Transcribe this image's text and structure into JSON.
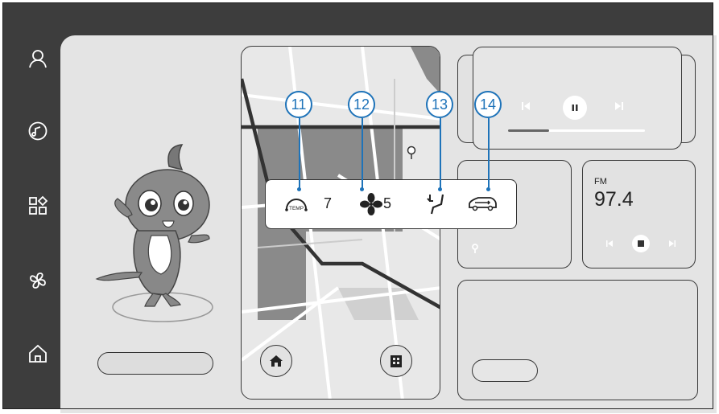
{
  "sidebar": {
    "items": [
      {
        "name": "profile-icon"
      },
      {
        "name": "music-icon"
      },
      {
        "name": "apps-icon"
      },
      {
        "name": "fan-icon"
      },
      {
        "name": "home-icon"
      }
    ]
  },
  "climate": {
    "temp_label": "TEMP",
    "temp_value": "7",
    "fan_value": "5"
  },
  "callouts": [
    "11",
    "12",
    "13",
    "14"
  ],
  "radio": {
    "band": "FM",
    "frequency": "97.4"
  },
  "media": {
    "progress": 0.3
  },
  "colors": {
    "callout": "#1e73b9",
    "frame": "#3d3d3d",
    "panel": "#e4e4e4"
  }
}
